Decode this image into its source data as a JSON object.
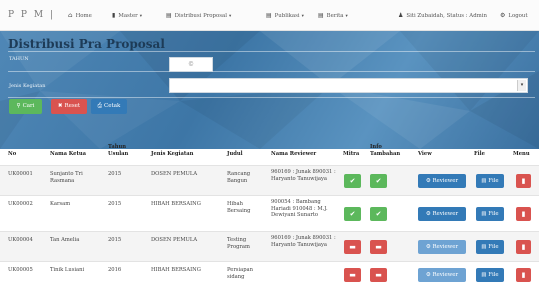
{
  "brand": "P P M |",
  "nav": {
    "home": "Home",
    "master": "Master",
    "distribusi": "Distribusi Proposal",
    "publikasi": "Publikasi",
    "berita": "Berita",
    "user": "Siti Zubaidah, Status : Admin",
    "logout": "Logout"
  },
  "page_title": "Distribusi Pra Proposal",
  "form": {
    "tahun_label": "TAHUN",
    "tahun_value": "©",
    "jenis_label": "Jenis Kegiatan",
    "cari": "Cari",
    "reset": "Reset",
    "cetak": "Cetak"
  },
  "columns": [
    "No",
    "Nama Ketua",
    "Tahun Usulan",
    "Jenis Kegiatan",
    "Judul",
    "Nama Reviewer",
    "Mitra",
    "Info Tambahan",
    "View",
    "File",
    "Menu"
  ],
  "rows": [
    {
      "no": "UK00001",
      "ketua": "Sunjanto Tri Rasmana",
      "tahun": "2015",
      "jenis": "DOSEN PEMULA",
      "judul": "Rancang Bangun",
      "reviewer": "960169 : Junak 890031 : Haryanto Tanuwijaya",
      "mitra": "ok",
      "info": "ok",
      "view": "Reviewer",
      "file": "File"
    },
    {
      "no": "UK00002",
      "ketua": "Karsam",
      "tahun": "2015",
      "jenis": "HIBAH BERSAING",
      "judul": "Hibah Bersaing",
      "reviewer": "900054 : Bambang Hariadi 910048 : M.J. Dewiyani Sunarto",
      "mitra": "ok",
      "info": "ok",
      "view": "Reviewer",
      "file": "File"
    },
    {
      "no": "UK00004",
      "ketua": "Tan Amelia",
      "tahun": "2015",
      "jenis": "DOSEN PEMULA",
      "judul": "Testing Program",
      "reviewer": "960169 : Junak 890031 : Haryanto Tanuwijaya",
      "mitra": "no",
      "info": "no",
      "view": "Reviewer",
      "file": "File"
    },
    {
      "no": "UK00005",
      "ketua": "Tinik Lusiani",
      "tahun": "2016",
      "jenis": "HIBAH BERSAING",
      "judul": "Persiapan sidang",
      "reviewer": "",
      "mitra": "no",
      "info": "no",
      "view": "Reviewer",
      "file": "File"
    }
  ],
  "icons": {
    "check": "✔",
    "minus": "▬",
    "trash": "🗑",
    "gear": "⚙",
    "file": "▤",
    "search": "🔍",
    "times": "✖",
    "print": "⎙"
  },
  "colors": {
    "green": "#5cb85c",
    "red": "#d9534f",
    "blue": "#337ab7",
    "banner": "#4f87b6"
  }
}
